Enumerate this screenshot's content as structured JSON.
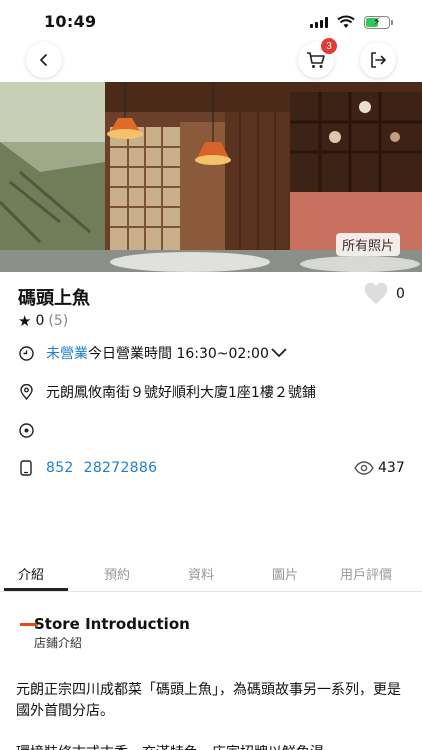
{
  "status_bar": {
    "time": "10:49"
  },
  "cart": {
    "badge": "3"
  },
  "hero": {
    "all_photos_label": "所有照片"
  },
  "store": {
    "name": "碼頭上魚",
    "likes": "0",
    "rating": "0",
    "rating_count": "(5)",
    "status": "未營業",
    "hours": "今日營業時間 16:30~02:00",
    "address": "元朗鳳攸南街９號好順利大廈1座1樓２號鋪",
    "phone_code": "852",
    "phone_number": "28272886",
    "views": "437"
  },
  "tabs": [
    {
      "label": "介紹",
      "active": true
    },
    {
      "label": "預約"
    },
    {
      "label": "資料"
    },
    {
      "label": "圖片"
    },
    {
      "label": "用戶評價"
    }
  ],
  "intro": {
    "title": "Store Introduction",
    "subtitle": "店鋪介紹",
    "body": "元朗正宗四川成都菜「碼頭上魚」，為碼頭故事另一系列，更是國外首間分店。",
    "more": "環境裝修古式古香，充滿特色，店家招牌以鮮魚湯"
  },
  "colors": {
    "accent_blue": "#1e7fd0",
    "badge_red": "#e53935",
    "intro_mark": "#e64a19"
  },
  "icons": [
    "back-icon",
    "cart-icon",
    "logout-icon",
    "heart-icon",
    "star-icon",
    "clock-icon",
    "location-icon",
    "extra-info-icon",
    "phone-icon",
    "eye-icon",
    "chevron-down-icon"
  ]
}
